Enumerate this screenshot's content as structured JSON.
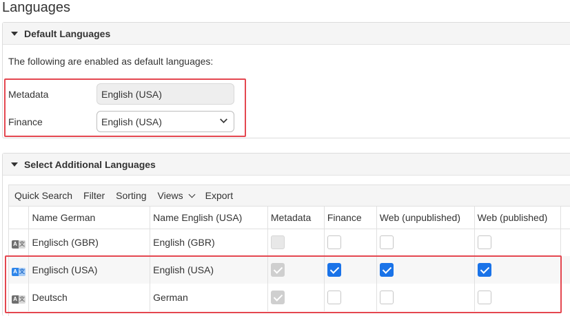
{
  "page": {
    "title": "Languages"
  },
  "default_languages": {
    "header": "Default Languages",
    "intro": "The following are enabled as default languages:",
    "metadata": {
      "label": "Metadata",
      "value": "English (USA)"
    },
    "finance": {
      "label": "Finance",
      "value": "English (USA)"
    }
  },
  "additional_languages": {
    "header": "Select Additional Languages",
    "toolbar": {
      "quick_search": "Quick Search",
      "filter": "Filter",
      "sorting": "Sorting",
      "views": "Views",
      "export": "Export"
    },
    "columns": [
      "Name German",
      "Name English (USA)",
      "Metadata",
      "Finance",
      "Web (unpublished)",
      "Web (published)"
    ],
    "rows": [
      {
        "name_german": "Englisch (GBR)",
        "name_english": "English (GBR)",
        "icon": "language-icon-gray",
        "metadata": false,
        "finance": false,
        "web_unpublished": false,
        "web_published": false
      },
      {
        "name_german": "Englisch (USA)",
        "name_english": "English (USA)",
        "icon": "language-icon-blue",
        "metadata": true,
        "finance": true,
        "web_unpublished": true,
        "web_published": true
      },
      {
        "name_german": "Deutsch",
        "name_english": "German",
        "icon": "language-icon-gray",
        "metadata": true,
        "finance": false,
        "web_unpublished": false,
        "web_published": false
      }
    ]
  },
  "colors": {
    "accent": "#1a73e8",
    "highlight": "#e4464f"
  }
}
